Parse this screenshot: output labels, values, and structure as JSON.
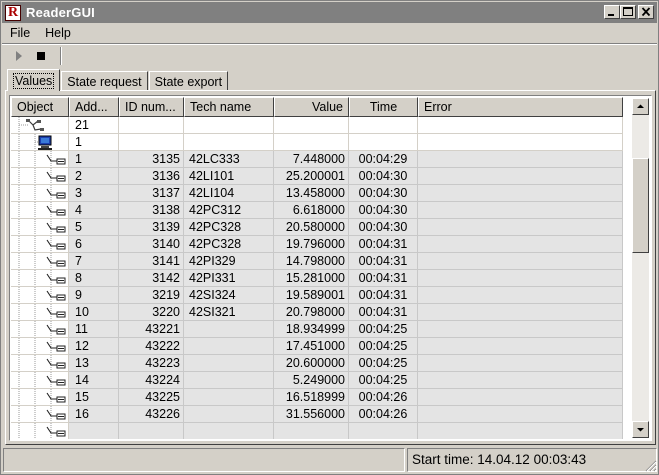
{
  "window": {
    "title": "ReaderGUI",
    "icon_letter": "R"
  },
  "menu": {
    "items": [
      "File",
      "Help"
    ]
  },
  "toolbar": {
    "buttons": [
      "play-icon",
      "stop-icon"
    ]
  },
  "tabs": [
    {
      "label": "Values",
      "active": true
    },
    {
      "label": "State request",
      "active": false
    },
    {
      "label": "State export",
      "active": false
    }
  ],
  "grid": {
    "columns": [
      "Object",
      "Add...",
      "ID num...",
      "Tech name",
      "Value",
      "Time",
      "Error"
    ],
    "rows": [
      {
        "level": 0,
        "address": "21",
        "id": "",
        "tech": "",
        "value": "",
        "time": "",
        "error": ""
      },
      {
        "level": 1,
        "address": "1",
        "id": "",
        "tech": "",
        "value": "",
        "time": "",
        "error": ""
      },
      {
        "level": 2,
        "address": "1",
        "id": "3135",
        "tech": "42LC333",
        "value": "7.448000",
        "time": "00:04:29",
        "error": ""
      },
      {
        "level": 2,
        "address": "2",
        "id": "3136",
        "tech": "42LI101",
        "value": "25.200001",
        "time": "00:04:30",
        "error": ""
      },
      {
        "level": 2,
        "address": "3",
        "id": "3137",
        "tech": "42LI104",
        "value": "13.458000",
        "time": "00:04:30",
        "error": ""
      },
      {
        "level": 2,
        "address": "4",
        "id": "3138",
        "tech": "42PC312",
        "value": "6.618000",
        "time": "00:04:30",
        "error": ""
      },
      {
        "level": 2,
        "address": "5",
        "id": "3139",
        "tech": "42PC328",
        "value": "20.580000",
        "time": "00:04:30",
        "error": ""
      },
      {
        "level": 2,
        "address": "6",
        "id": "3140",
        "tech": "42PC328",
        "value": "19.796000",
        "time": "00:04:31",
        "error": ""
      },
      {
        "level": 2,
        "address": "7",
        "id": "3141",
        "tech": "42PI329",
        "value": "14.798000",
        "time": "00:04:31",
        "error": ""
      },
      {
        "level": 2,
        "address": "8",
        "id": "3142",
        "tech": "42PI331",
        "value": "15.281000",
        "time": "00:04:31",
        "error": ""
      },
      {
        "level": 2,
        "address": "9",
        "id": "3219",
        "tech": "42SI324",
        "value": "19.589001",
        "time": "00:04:31",
        "error": ""
      },
      {
        "level": 2,
        "address": "10",
        "id": "3220",
        "tech": "42SI321",
        "value": "20.798000",
        "time": "00:04:31",
        "error": ""
      },
      {
        "level": 2,
        "address": "11",
        "id": "43221",
        "tech": "",
        "value": "18.934999",
        "time": "00:04:25",
        "error": ""
      },
      {
        "level": 2,
        "address": "12",
        "id": "43222",
        "tech": "",
        "value": "17.451000",
        "time": "00:04:25",
        "error": ""
      },
      {
        "level": 2,
        "address": "13",
        "id": "43223",
        "tech": "",
        "value": "20.600000",
        "time": "00:04:25",
        "error": ""
      },
      {
        "level": 2,
        "address": "14",
        "id": "43224",
        "tech": "",
        "value": "5.249000",
        "time": "00:04:25",
        "error": ""
      },
      {
        "level": 2,
        "address": "15",
        "id": "43225",
        "tech": "",
        "value": "16.518999",
        "time": "00:04:26",
        "error": ""
      },
      {
        "level": 2,
        "address": "16",
        "id": "43226",
        "tech": "",
        "value": "31.556000",
        "time": "00:04:26",
        "error": ""
      },
      {
        "level": 2,
        "address": "",
        "id": "",
        "tech": "",
        "value": "",
        "time": "",
        "error": ""
      }
    ]
  },
  "status": {
    "left": "",
    "start_time": "Start time: 14.04.12  00:03:43"
  },
  "colors": {
    "face": "#d4d0c8",
    "title_inactive": "#808080",
    "leaf_row": "#e4e4e4"
  }
}
